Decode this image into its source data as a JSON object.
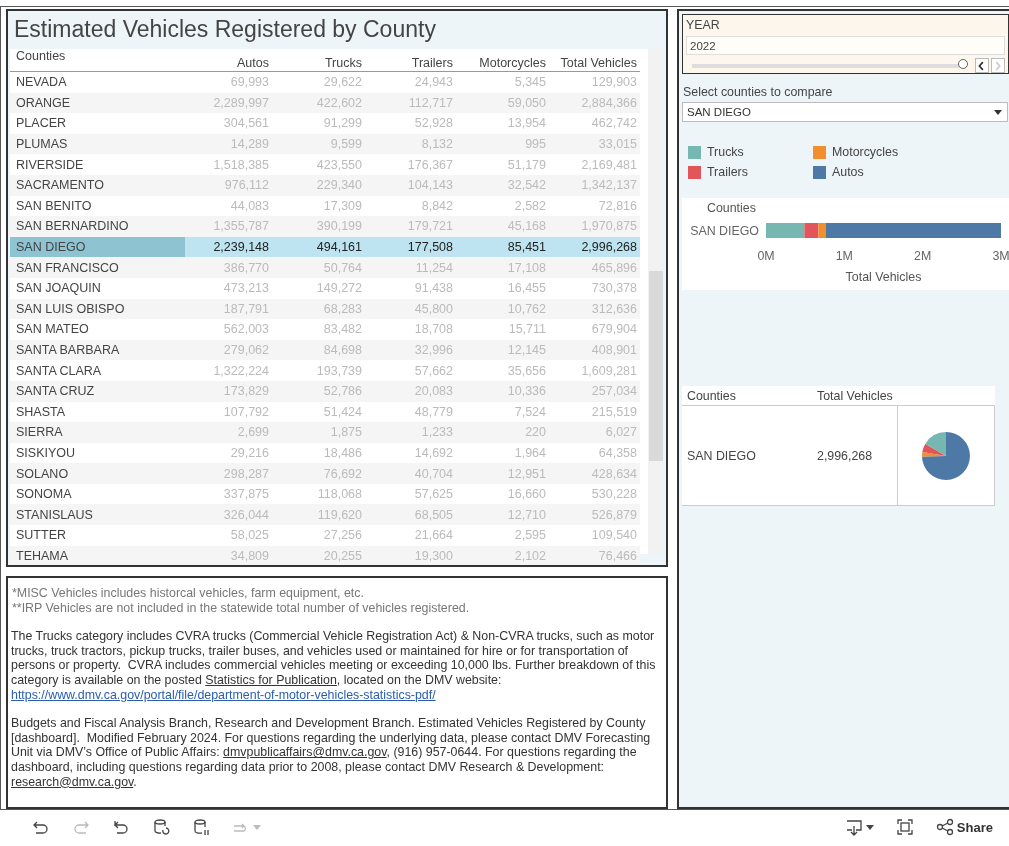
{
  "table": {
    "title": "Estimated Vehicles Registered by County",
    "columns": [
      "Counties",
      "Autos",
      "Trucks",
      "Trailers",
      "Motorcycles",
      "Total Vehicles"
    ],
    "rows": [
      {
        "county": "NEVADA",
        "values": [
          "69,993",
          "29,622",
          "24,943",
          "5,345",
          "129,903"
        ],
        "selected": false
      },
      {
        "county": "ORANGE",
        "values": [
          "2,289,997",
          "422,602",
          "112,717",
          "59,050",
          "2,884,366"
        ],
        "selected": false
      },
      {
        "county": "PLACER",
        "values": [
          "304,561",
          "91,299",
          "52,928",
          "13,954",
          "462,742"
        ],
        "selected": false
      },
      {
        "county": "PLUMAS",
        "values": [
          "14,289",
          "9,599",
          "8,132",
          "995",
          "33,015"
        ],
        "selected": false
      },
      {
        "county": "RIVERSIDE",
        "values": [
          "1,518,385",
          "423,550",
          "176,367",
          "51,179",
          "2,169,481"
        ],
        "selected": false
      },
      {
        "county": "SACRAMENTO",
        "values": [
          "976,112",
          "229,340",
          "104,143",
          "32,542",
          "1,342,137"
        ],
        "selected": false
      },
      {
        "county": "SAN BENITO",
        "values": [
          "44,083",
          "17,309",
          "8,842",
          "2,582",
          "72,816"
        ],
        "selected": false
      },
      {
        "county": "SAN BERNARDINO",
        "values": [
          "1,355,787",
          "390,199",
          "179,721",
          "45,168",
          "1,970,875"
        ],
        "selected": false
      },
      {
        "county": "SAN DIEGO",
        "values": [
          "2,239,148",
          "494,161",
          "177,508",
          "85,451",
          "2,996,268"
        ],
        "selected": true
      },
      {
        "county": "SAN FRANCISCO",
        "values": [
          "386,770",
          "50,764",
          "11,254",
          "17,108",
          "465,896"
        ],
        "selected": false
      },
      {
        "county": "SAN JOAQUIN",
        "values": [
          "473,213",
          "149,272",
          "91,438",
          "16,455",
          "730,378"
        ],
        "selected": false
      },
      {
        "county": "SAN LUIS OBISPO",
        "values": [
          "187,791",
          "68,283",
          "45,800",
          "10,762",
          "312,636"
        ],
        "selected": false
      },
      {
        "county": "SAN MATEO",
        "values": [
          "562,003",
          "83,482",
          "18,708",
          "15,711",
          "679,904"
        ],
        "selected": false
      },
      {
        "county": "SANTA BARBARA",
        "values": [
          "279,062",
          "84,698",
          "32,996",
          "12,145",
          "408,901"
        ],
        "selected": false
      },
      {
        "county": "SANTA CLARA",
        "values": [
          "1,322,224",
          "193,739",
          "57,662",
          "35,656",
          "1,609,281"
        ],
        "selected": false
      },
      {
        "county": "SANTA CRUZ",
        "values": [
          "173,829",
          "52,786",
          "20,083",
          "10,336",
          "257,034"
        ],
        "selected": false
      },
      {
        "county": "SHASTA",
        "values": [
          "107,792",
          "51,424",
          "48,779",
          "7,524",
          "215,519"
        ],
        "selected": false
      },
      {
        "county": "SIERRA",
        "values": [
          "2,699",
          "1,875",
          "1,233",
          "220",
          "6,027"
        ],
        "selected": false
      },
      {
        "county": "SISKIYOU",
        "values": [
          "29,216",
          "18,486",
          "14,692",
          "1,964",
          "64,358"
        ],
        "selected": false
      },
      {
        "county": "SOLANO",
        "values": [
          "298,287",
          "76,692",
          "40,704",
          "12,951",
          "428,634"
        ],
        "selected": false
      },
      {
        "county": "SONOMA",
        "values": [
          "337,875",
          "118,068",
          "57,625",
          "16,660",
          "530,228"
        ],
        "selected": false
      },
      {
        "county": "STANISLAUS",
        "values": [
          "326,044",
          "119,620",
          "68,505",
          "12,710",
          "526,879"
        ],
        "selected": false
      },
      {
        "county": "SUTTER",
        "values": [
          "58,025",
          "27,256",
          "21,664",
          "2,595",
          "109,540"
        ],
        "selected": false
      },
      {
        "county": "TEHAMA",
        "values": [
          "34,809",
          "20,255",
          "19,300",
          "2,102",
          "76,466"
        ],
        "selected": false
      }
    ]
  },
  "notes": {
    "footnotes": [
      "*MISC Vehicles includes historcal vehicles, farm equipment, etc.",
      "**IRP Vehicles are not included in the statewide total number of vehicles registered."
    ],
    "paragraphs": [
      [
        {
          "kind": "text",
          "text": "The Trucks category includes CVRA trucks (Commercial Vehicle Registration Act) & Non-CVRA trucks, such as motor trucks, truck tractors, pickup trucks, trailer buses, and vehicles used or maintained for hire or for transportation of persons or property.  CVRA includes commercial vehicles meeting or exceeding 10,000 lbs. Further breakdown of this category is available on the posted "
        },
        {
          "kind": "link",
          "text": "Statistics for Publication"
        },
        {
          "kind": "text",
          "text": ", located on the DMV website: "
        },
        {
          "kind": "url",
          "text": "https://www.dmv.ca.gov/portal/file/department-of-motor-vehicles-statistics-pdf/"
        }
      ],
      [
        {
          "kind": "text",
          "text": "Budgets and Fiscal Analysis Branch, Research and Development Branch. Estimated Vehicles Registered by County [dashboard].  Modified February 2024. For questions regarding the underlying data, please contact DMV Forecasting Unit via DMV’s Office of Public Affairs: "
        },
        {
          "kind": "link",
          "text": "dmvpublicaffairs@dmv.ca.gov"
        },
        {
          "kind": "text",
          "text": ", (916) 957-0644. For questions regarding the dashboard, including questions regarding data prior to 2008, please contact DMV Research & Development: "
        },
        {
          "kind": "link",
          "text": "research@dmv.ca.gov"
        },
        {
          "kind": "text",
          "text": "."
        }
      ]
    ]
  },
  "year_filter": {
    "label": "YEAR",
    "value": "2022",
    "level": 1,
    "step_buttons": [
      {
        "kind": "previous",
        "disabled": false
      },
      {
        "kind": "next",
        "disabled": true
      }
    ]
  },
  "county_select": {
    "label": "Select counties to compare",
    "value": "SAN DIEGO"
  },
  "bar_chart": {
    "chart_data": {
      "type": "bar",
      "orientation": "horizontal",
      "stacked": true,
      "xlabel": "Total Vehicles",
      "ylabel": "Counties",
      "categories": [
        "SAN DIEGO"
      ],
      "series": [
        {
          "name": "Trucks",
          "color": "#76b7b2",
          "values": [
            490000
          ]
        },
        {
          "name": "Trailers",
          "color": "#e15759",
          "values": [
            180000
          ]
        },
        {
          "name": "Motorcycles",
          "color": "#f28e2b",
          "values": [
            90000
          ]
        },
        {
          "name": "Autos",
          "color": "#4e79a7",
          "values": [
            2240000
          ]
        }
      ],
      "xlim": [
        0,
        3000000
      ],
      "xticks": [
        {
          "value": 0,
          "label": "0M"
        },
        {
          "value": 1000000,
          "label": "1M"
        },
        {
          "value": 2000000,
          "label": "2M"
        },
        {
          "value": 3000000,
          "label": "3M"
        }
      ]
    }
  },
  "summary": {
    "columns": [
      "Counties",
      "Total Vehicles"
    ],
    "rows": [
      {
        "county": "SAN DIEGO",
        "total": "2,996,268"
      }
    ]
  },
  "toolbar": {
    "left": [
      {
        "kind": "undo",
        "disabled": false
      },
      {
        "kind": "redo",
        "disabled": true
      },
      {
        "kind": "revert",
        "disabled": false
      },
      {
        "kind": "refresh",
        "disabled": false
      },
      {
        "kind": "pause",
        "disabled": false
      },
      {
        "kind": "forward",
        "disabled": true
      }
    ],
    "right": [
      {
        "kind": "download"
      },
      {
        "kind": "fullscreen"
      },
      {
        "kind": "share",
        "label": "Share"
      }
    ]
  }
}
